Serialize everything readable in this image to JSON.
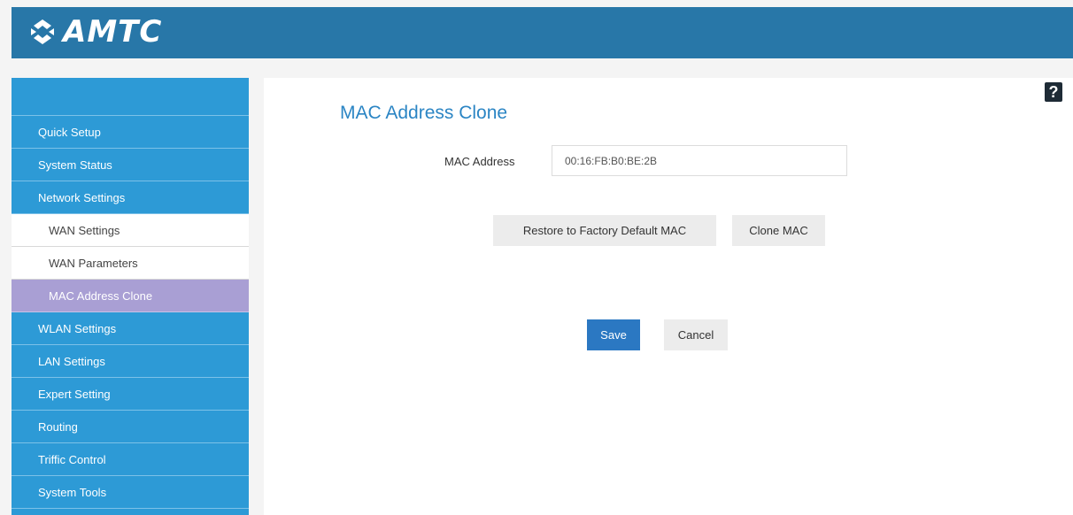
{
  "brand": {
    "logo_text": "AMTC"
  },
  "help": {
    "icon_label": "?"
  },
  "sidebar": {
    "items": [
      {
        "label": "Quick Setup",
        "type": "main"
      },
      {
        "label": "System Status",
        "type": "main"
      },
      {
        "label": "Network Settings",
        "type": "main"
      },
      {
        "label": "WAN Settings",
        "type": "sub"
      },
      {
        "label": "WAN Parameters",
        "type": "sub"
      },
      {
        "label": "MAC Address Clone",
        "type": "active"
      },
      {
        "label": "WLAN Settings",
        "type": "main"
      },
      {
        "label": "LAN Settings",
        "type": "main"
      },
      {
        "label": "Expert Setting",
        "type": "main"
      },
      {
        "label": "Routing",
        "type": "main"
      },
      {
        "label": "Triffic Control",
        "type": "main"
      },
      {
        "label": "System Tools",
        "type": "main"
      }
    ]
  },
  "main": {
    "title": "MAC Address Clone",
    "mac_label": "MAC Address",
    "mac_value": "00:16:FB:B0:BE:2B",
    "restore_label": "Restore to Factory Default MAC",
    "clone_label": "Clone MAC",
    "save_label": "Save",
    "cancel_label": "Cancel"
  },
  "colors": {
    "header": "#2877a8",
    "sidebar": "#2d9ad6",
    "active_item": "#a99fd4",
    "title": "#2b85c4",
    "save_button": "#2b78c2"
  }
}
